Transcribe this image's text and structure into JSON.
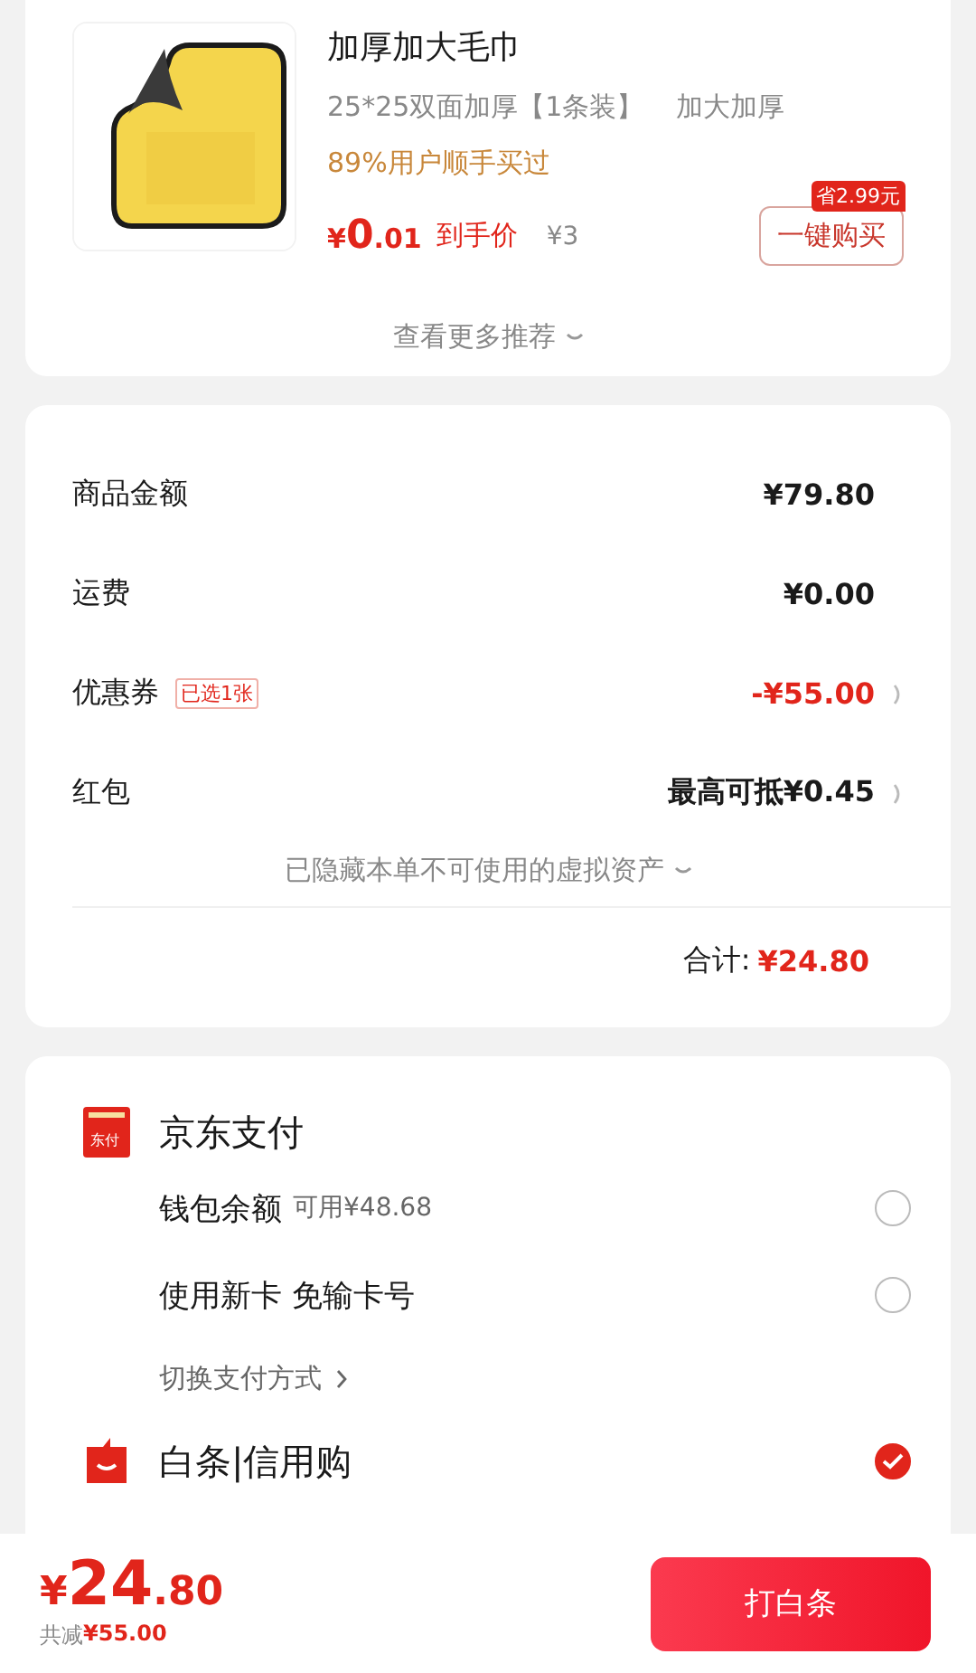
{
  "product": {
    "title": "加厚加大毛巾",
    "spec": "25*25双面加厚【1条装】",
    "spec_extra": "加大加厚",
    "social_proof": "89%用户顺手买过",
    "price_symbol": "¥",
    "price_int": "0",
    "price_dec": ".01",
    "price_label": "到手价",
    "original_price": "¥3",
    "save_badge": "省2.99元",
    "buy_button": "一键购买",
    "more": "查看更多推荐"
  },
  "summary": {
    "rows": [
      {
        "kind": "plain",
        "label": "商品金额",
        "value": "¥79.80"
      },
      {
        "kind": "plain",
        "label": "运费",
        "value": "¥0.00"
      },
      {
        "kind": "discount",
        "label": "优惠券",
        "tag": "已选1张",
        "value": "-¥55.00"
      },
      {
        "kind": "link",
        "label": "红包",
        "value": "最高可抵¥0.45"
      }
    ],
    "hidden_note": "已隐藏本单不可使用的虚拟资产",
    "total_label": "合计:",
    "total": "¥24.80"
  },
  "payment": {
    "groups": [
      {
        "kind": "jdpay",
        "title": "京东支付",
        "icon_text": "东付",
        "options": [
          {
            "label": "钱包余额",
            "sub": "可用¥48.68",
            "selected": false
          },
          {
            "label": "使用新卡 免输卡号",
            "selected": false
          }
        ],
        "switch": "切换支付方式"
      },
      {
        "kind": "baitiao",
        "title": "白条|信用购",
        "selected": true
      }
    ]
  },
  "bottom": {
    "symbol": "¥",
    "int": "24",
    "dec": ".80",
    "saved_label": "共减",
    "saved": "¥55.00",
    "button": "打白条"
  }
}
